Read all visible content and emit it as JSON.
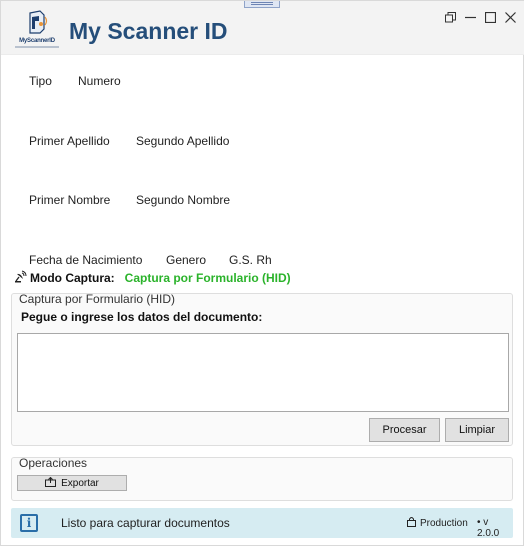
{
  "app": {
    "title": "My Scanner ID",
    "logo_text": "MyScannerID"
  },
  "fields": {
    "tipo": "Tipo",
    "numero": "Numero",
    "primer_apellido": "Primer Apellido",
    "segundo_apellido": "Segundo Apellido",
    "primer_nombre": "Primer Nombre",
    "segundo_nombre": "Segundo Nombre",
    "fecha_nacimiento": "Fecha de Nacimiento",
    "genero": "Genero",
    "gs_rh": "G.S. Rh"
  },
  "mode": {
    "label": "Modo Captura:",
    "value": "Captura por Formulario (HID)",
    "value_color": "#2bb32b"
  },
  "capture_group": {
    "title": "Captura por Formulario (HID)",
    "prompt": "Pegue o ingrese los datos del documento:",
    "textarea_value": "",
    "process_label": "Procesar",
    "clear_label": "Limpiar"
  },
  "operations": {
    "title": "Operaciones",
    "export_label": "Exportar"
  },
  "status": {
    "message": "Listo para capturar documentos",
    "environment": "Production",
    "version": "• v 2.0.0",
    "background": "#d6ecf2"
  },
  "icons": {
    "logo": "scanner-logo-icon",
    "restore": "restore-window-icon",
    "maximize": "maximize-window-icon",
    "close": "close-window-icon",
    "mode": "satellite-dish-icon",
    "export": "export-icon",
    "info": "info-icon",
    "lock": "lock-icon"
  }
}
